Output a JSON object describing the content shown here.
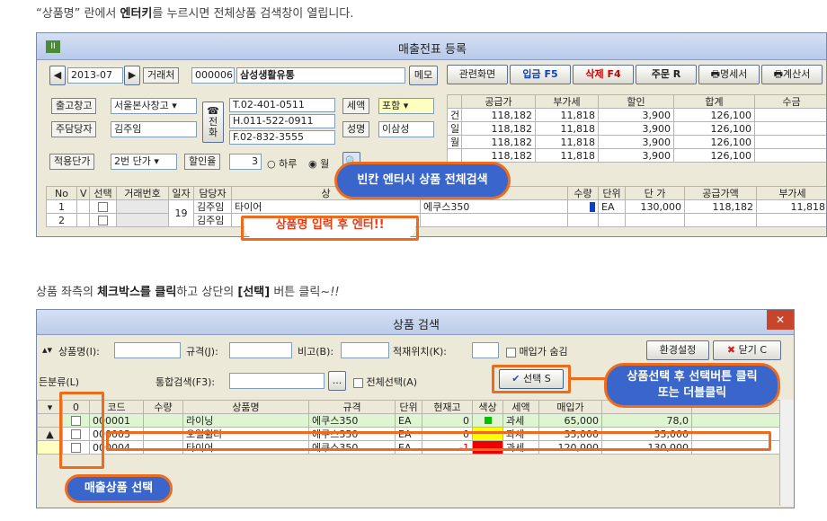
{
  "captions": {
    "top": {
      "q": "“상품명” 란에서 ",
      "b": "엔터키",
      "rest": "를 누르시면 전체상품 검색창이 열립니다."
    },
    "mid": {
      "a": "상품 좌측의 ",
      "b1": "체크박스를 클릭",
      "c": "하고 상단의 ",
      "b2": "[선택]",
      "d": " 버튼 클릭~",
      "e": "!!"
    }
  },
  "win1": {
    "title": "매출전표 등록",
    "app_icon": "II",
    "date": "2013-07",
    "partner_label": "거래처",
    "partner_code": "000006",
    "partner_name": "삼성생활유통",
    "memo": "메모",
    "buttons": [
      "관련화면",
      "입금 F5",
      "삭제 F4",
      "주문 R",
      "명세서",
      "계산서"
    ],
    "warehouse_label": "출고창고",
    "warehouse": "서울본사창고",
    "manager_label": "주담당자",
    "manager": "김주임",
    "phone_icon": "☎\n전\n화",
    "tel": "T.02-401-0511",
    "hp": "H.011-522-0911",
    "fax": "F.02-832-3555",
    "tax_label": "세액",
    "tax": "포함",
    "name_label": "성명",
    "name": "이삼성",
    "price_label": "적용단가",
    "price": "2번 단가",
    "discount_label": "할인율",
    "discount": "3",
    "radio_daily": "하루",
    "radio_month": "월",
    "summary": {
      "headers": [
        "공급가",
        "부가세",
        "할인",
        "합계",
        "수금"
      ],
      "rows": [
        {
          "k": "건",
          "v": [
            "118,182",
            "11,818",
            "3,900",
            "126,100"
          ]
        },
        {
          "k": "일",
          "v": [
            "118,182",
            "11,818",
            "3,900",
            "126,100"
          ]
        },
        {
          "k": "월",
          "v": [
            "118,182",
            "11,818",
            "3,900",
            "126,100"
          ]
        },
        {
          "k": "",
          "v": [
            "118,182",
            "11,818",
            "3,900",
            "126,100"
          ]
        }
      ]
    },
    "grid": {
      "headers": [
        "No",
        "V",
        "선택",
        "거래번호",
        "일자",
        "담당자",
        "상",
        "격",
        "수량",
        "단위",
        "단 가",
        "공급가액",
        "부가세"
      ],
      "rows": [
        {
          "no": "1",
          "date": "19",
          "mgr": "김주임",
          "name": "타이어",
          "spec": "에쿠스350",
          "unit": "EA",
          "price": "130,000",
          "supply": "118,182",
          "vat": "11,818"
        },
        {
          "no": "2",
          "mgr": "김주임"
        }
      ]
    }
  },
  "callout1": "빈칸 엔터시 상품 전체검색",
  "callout2": "상품명 입력 후 엔터!!",
  "win2": {
    "title": "상품 검색",
    "close": "✕",
    "f_name": "상품명(I):",
    "f_spec": "규격(J):",
    "f_note": "비고(B):",
    "f_loc": "적재위치(K):",
    "hide_label": "매입가 숨김",
    "env": "환경설정",
    "closebtn": "닫기 C",
    "cat": "든분류(L)",
    "total": "통합검색(F3):",
    "dots": "...",
    "selall": "전체선택(A)",
    "select": "선택 S",
    "headers": [
      "0",
      "코드",
      "수량",
      "상품명",
      "규격",
      "단위",
      "현재고",
      "색상",
      "세액",
      "매입가",
      ""
    ],
    "rows": [
      {
        "code": "000001",
        "name": "라이닝",
        "spec": "에쿠스350",
        "unit": "EA",
        "stock": "0",
        "color": "#00c000",
        "tax": "과세",
        "buy": "65,000",
        "sell": "78,0"
      },
      {
        "code": "000003",
        "name": "오일휠타",
        "spec": "에쿠스350",
        "unit": "EA",
        "stock": "0",
        "color": "#ffff00",
        "tax": "과세",
        "buy": "35,000",
        "sell": "55,000"
      },
      {
        "code": "000004",
        "name": "타이어",
        "spec": "에쿠스350",
        "unit": "EA",
        "stock": "-1",
        "color": "#ee0000",
        "tax": "과세",
        "buy": "120,000",
        "sell": "130,000"
      }
    ]
  },
  "callout3": "상품선택 후 선택버튼 클릭\n또는 더블클릭",
  "callout4": "매출상품 선택"
}
